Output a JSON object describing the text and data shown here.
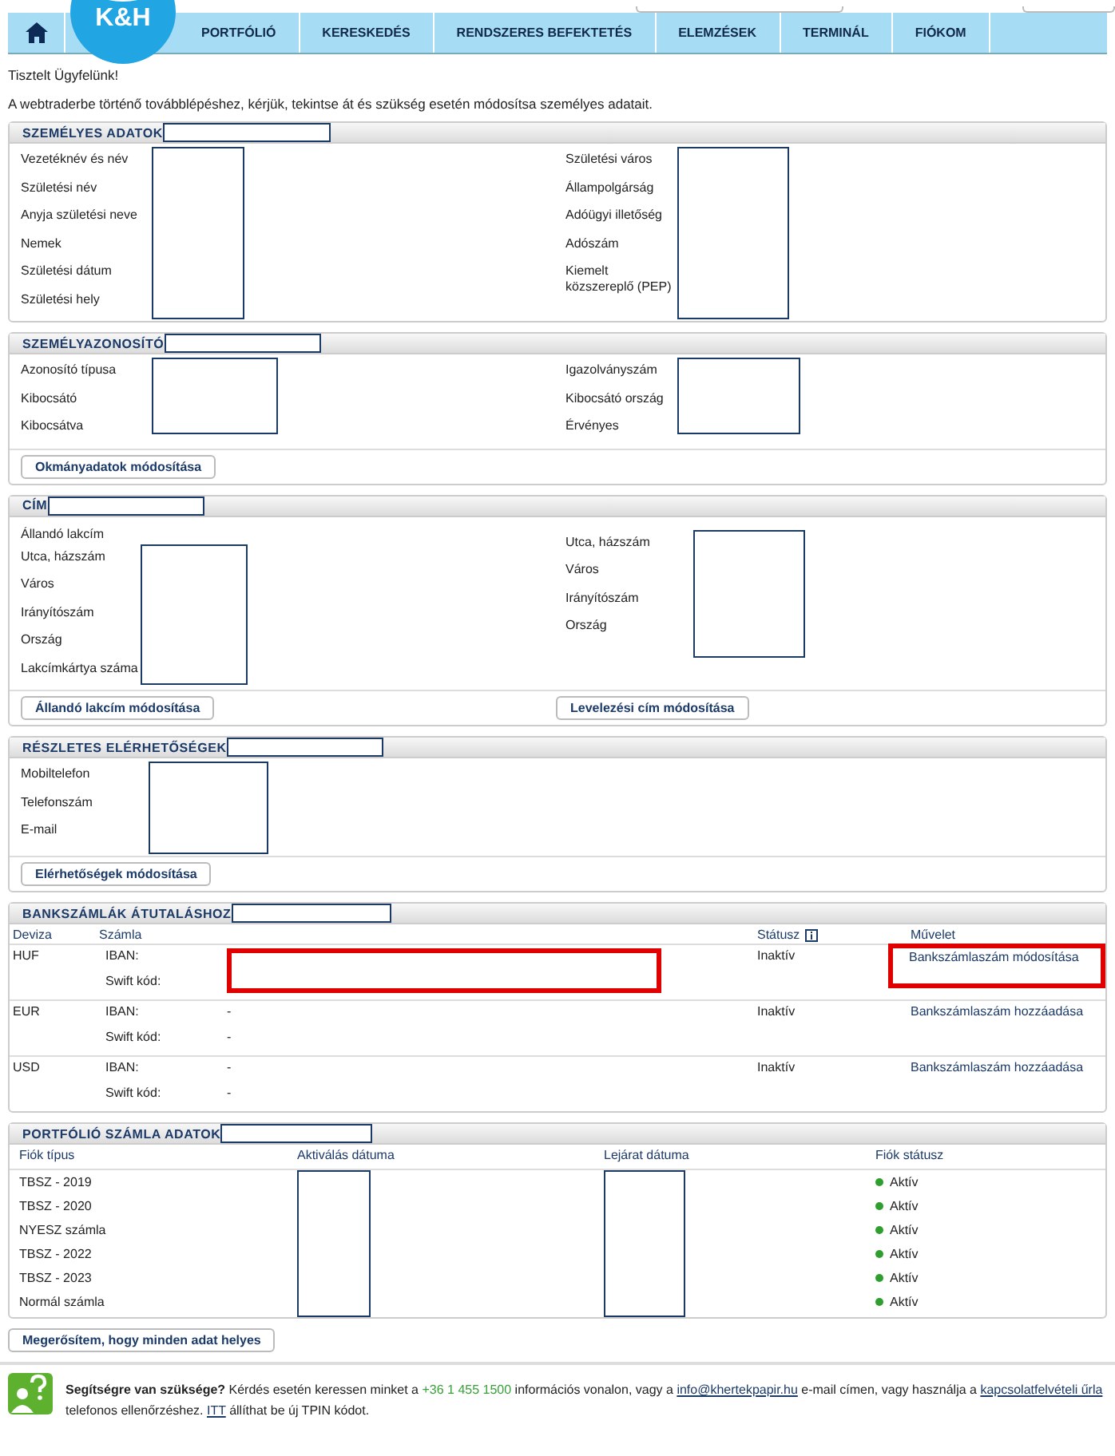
{
  "logo": {
    "text": "K&H"
  },
  "nav": {
    "tabs": [
      {
        "label": "PORTFÓLIÓ",
        "selected": false
      },
      {
        "label": "KERESKEDÉS",
        "selected": false
      },
      {
        "label": "RENDSZERES BEFEKTETÉS",
        "selected": false
      },
      {
        "label": "ELEMZÉSEK",
        "selected": false
      },
      {
        "label": "TERMINÁL",
        "selected": false
      },
      {
        "label": "FIÓKOM",
        "selected": false
      }
    ]
  },
  "greeting": "Tisztelt Ügyfelünk!",
  "intro": "A webtraderbe történő továbblépéshez, kérjük, tekintse át és szükség esetén módosítsa személyes adatait.",
  "sections": [
    {
      "kind": "fields",
      "title": "SZEMÉLYES ADATOK",
      "columns": [
        {
          "labels": [
            "Vezetéknév és név",
            "Születési név",
            "Anyja születési neve",
            "Nemek",
            "Születési dátum",
            "Születési hely"
          ]
        },
        {
          "labels": [
            "Születési város",
            "Állampolgárság",
            "Adóügyi illetőség",
            "Adószám",
            "Kiemelt közszereplő (PEP)"
          ]
        }
      ]
    },
    {
      "kind": "fields",
      "title": "SZEMÉLYAZONOSÍTÓ",
      "columns": [
        {
          "labels": [
            "Azonosító típusa",
            "Kibocsátó",
            "Kibocsátva"
          ]
        },
        {
          "labels": [
            "Igazolványszám",
            "Kibocsátó ország",
            "Érvényes"
          ]
        }
      ],
      "buttons": [
        "Okmányadatok módosítása"
      ]
    },
    {
      "kind": "fields",
      "title": "CÍM",
      "columns": [
        {
          "heading": "Állandó lakcím",
          "labels": [
            "Utca, házszám",
            "Város",
            "Irányítószám",
            "Ország",
            "Lakcímkártya száma"
          ]
        },
        {
          "labels": [
            "Utca, házszám",
            "Város",
            "Irányítószám",
            "Ország"
          ]
        }
      ],
      "buttons": [
        "Állandó lakcím módosítása",
        "Levelezési cím módosítása"
      ]
    },
    {
      "kind": "fields",
      "title": "RÉSZLETES ELÉRHETŐSÉGEK",
      "columns": [
        {
          "labels": [
            "Mobiltelefon",
            "Telefonszám",
            "E-mail"
          ]
        }
      ],
      "buttons": [
        "Elérhetőségek módosítása"
      ]
    },
    {
      "kind": "bank",
      "title": "BANKSZÁMLÁK ÁTUTALÁSHOZ",
      "columns": [
        "Deviza",
        "Számla",
        "Státusz",
        "Művelet"
      ],
      "rows": [
        {
          "currency": "HUF",
          "iban_label": "IBAN:",
          "swift_label": "Swift kód:",
          "status": "Inaktív",
          "action": "Bankszámlaszám módosítása",
          "highlighted": true
        },
        {
          "currency": "EUR",
          "iban_label": "IBAN:",
          "iban": "-",
          "swift_label": "Swift kód:",
          "swift": "-",
          "status": "Inaktív",
          "action": "Bankszámlaszám hozzáadása",
          "highlighted": false
        },
        {
          "currency": "USD",
          "iban_label": "IBAN:",
          "iban": "-",
          "swift_label": "Swift kód:",
          "swift": "-",
          "status": "Inaktív",
          "action": "Bankszámlaszám hozzáadása",
          "highlighted": false
        }
      ]
    },
    {
      "kind": "portfolio",
      "title": "PORTFÓLIÓ SZÁMLA ADATOK",
      "columns": [
        "Fiók típus",
        "Aktiválás dátuma",
        "Lejárat dátuma",
        "Fiók státusz"
      ],
      "rows": [
        {
          "type": "TBSZ - 2019",
          "status": "Aktív",
          "color": "#2e9e2e"
        },
        {
          "type": "TBSZ - 2020",
          "status": "Aktív",
          "color": "#2e9e2e"
        },
        {
          "type": "NYESZ számla",
          "status": "Aktív",
          "color": "#2e9e2e"
        },
        {
          "type": "TBSZ - 2022",
          "status": "Aktív",
          "color": "#2e9e2e"
        },
        {
          "type": "TBSZ - 2023",
          "status": "Aktív",
          "color": "#2e9e2e"
        },
        {
          "type": "Normál számla",
          "status": "Aktív",
          "color": "#2e9e2e"
        }
      ]
    }
  ],
  "confirm_button": "Megerősítem, hogy minden adat helyes",
  "help": {
    "parts": [
      {
        "kind": "bold",
        "text": "Segítségre van szüksége?"
      },
      {
        "kind": "text",
        "text": " Kérdés esetén keressen minket a "
      },
      {
        "kind": "phone",
        "text": "+36 1 455 1500"
      },
      {
        "kind": "text",
        "text": " információs vonalon, vagy a "
      },
      {
        "kind": "link",
        "text": "info@khertekpapir.hu"
      },
      {
        "kind": "text",
        "text": " e-mail címen, vagy használja a "
      },
      {
        "kind": "link",
        "text": "kapcsolatfelvételi űrla"
      },
      {
        "kind": "text",
        "text": " telefonos ellenőrzéshez. "
      },
      {
        "kind": "link",
        "text": "ITT"
      },
      {
        "kind": "text",
        "text": " állíthat be új TPIN kódot."
      }
    ]
  }
}
